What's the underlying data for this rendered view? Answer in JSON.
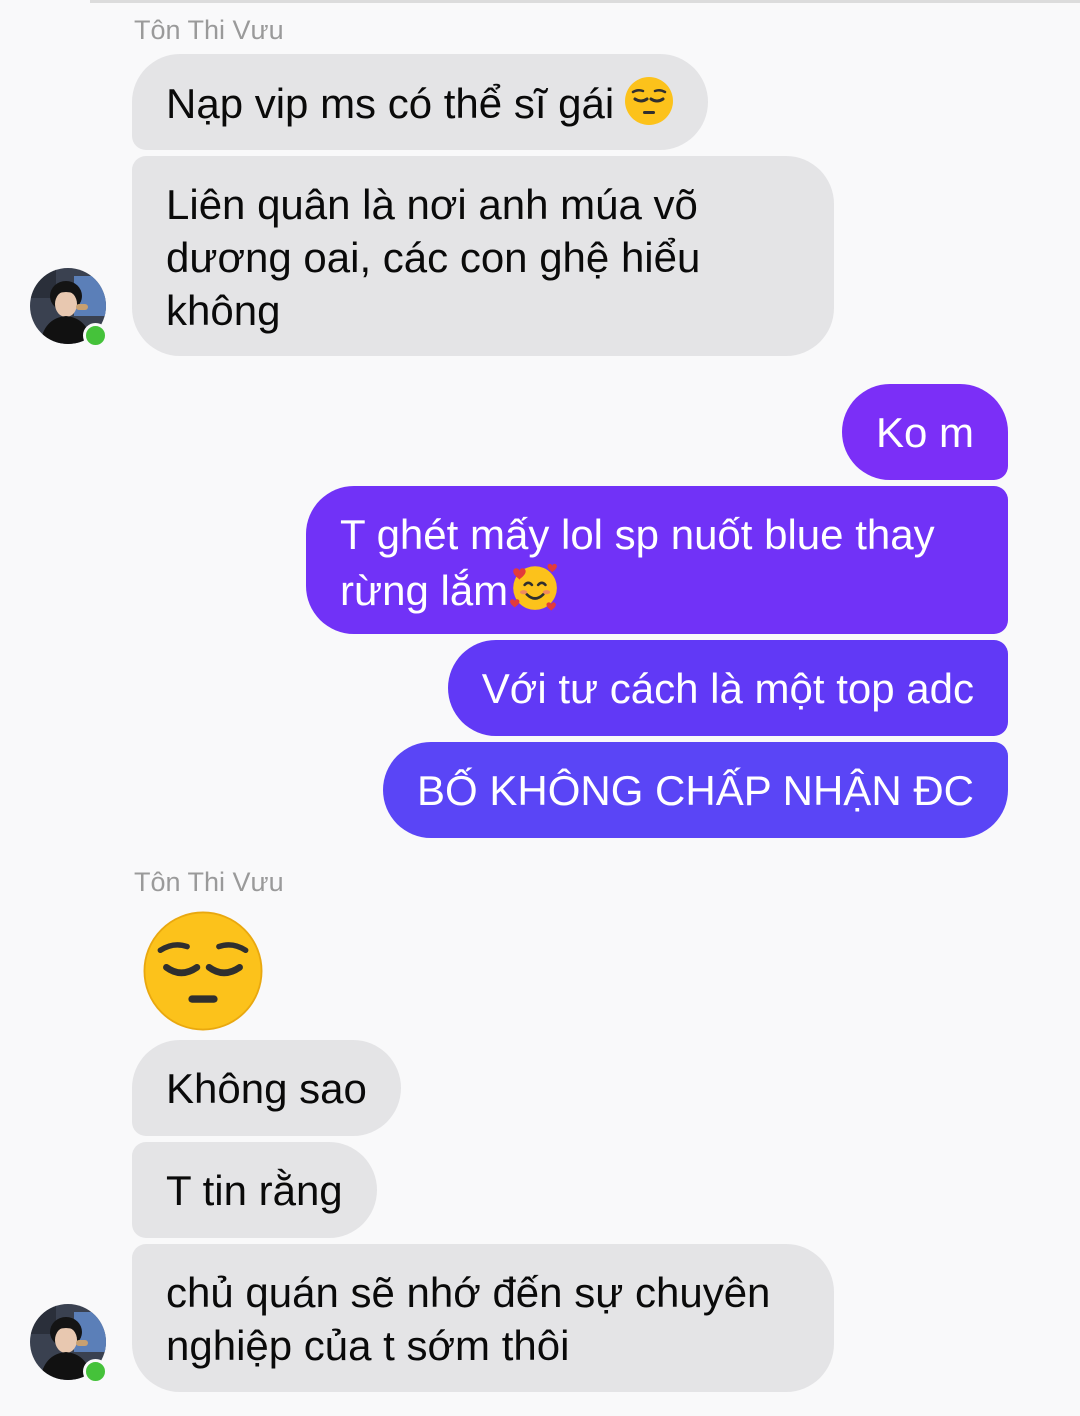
{
  "conversation": {
    "sender_name": "Tôn Thi Vưu",
    "colors": {
      "incoming_bubble": "#e4e4e6",
      "outgoing_gradient_top": "#7b2ff7",
      "outgoing_gradient_bottom": "#5a45f6",
      "online_dot": "#45c23a"
    },
    "group1": {
      "sender_name": "Tôn Thi Vưu",
      "messages": [
        {
          "text": "Nạp vip ms có thể sĩ gái",
          "emoji": "pensive-face"
        },
        {
          "text_line1": "Liên quân là nơi anh múa võ",
          "text_line2": "dương oai, các con ghệ hiểu",
          "text_line3": "không"
        }
      ]
    },
    "group2_outgoing": {
      "messages": [
        {
          "text": "Ko m"
        },
        {
          "text_line1": "T ghét mấy lol sp nuốt blue thay",
          "text_line2": "rừng lắm",
          "emoji": "smiling-face-with-hearts"
        },
        {
          "text": "Với tư cách là một top adc"
        },
        {
          "text": "BỐ KHÔNG CHẤP NHẬN ĐC"
        }
      ]
    },
    "group3": {
      "sender_name": "Tôn Thi Vưu",
      "big_emoji": "pensive-face",
      "messages": [
        {
          "text": "Không sao"
        },
        {
          "text": "T tin rằng"
        },
        {
          "text_line1": "chủ quán sẽ nhớ đến sự chuyên",
          "text_line2": "nghiệp của t sớm thôi"
        }
      ]
    }
  }
}
